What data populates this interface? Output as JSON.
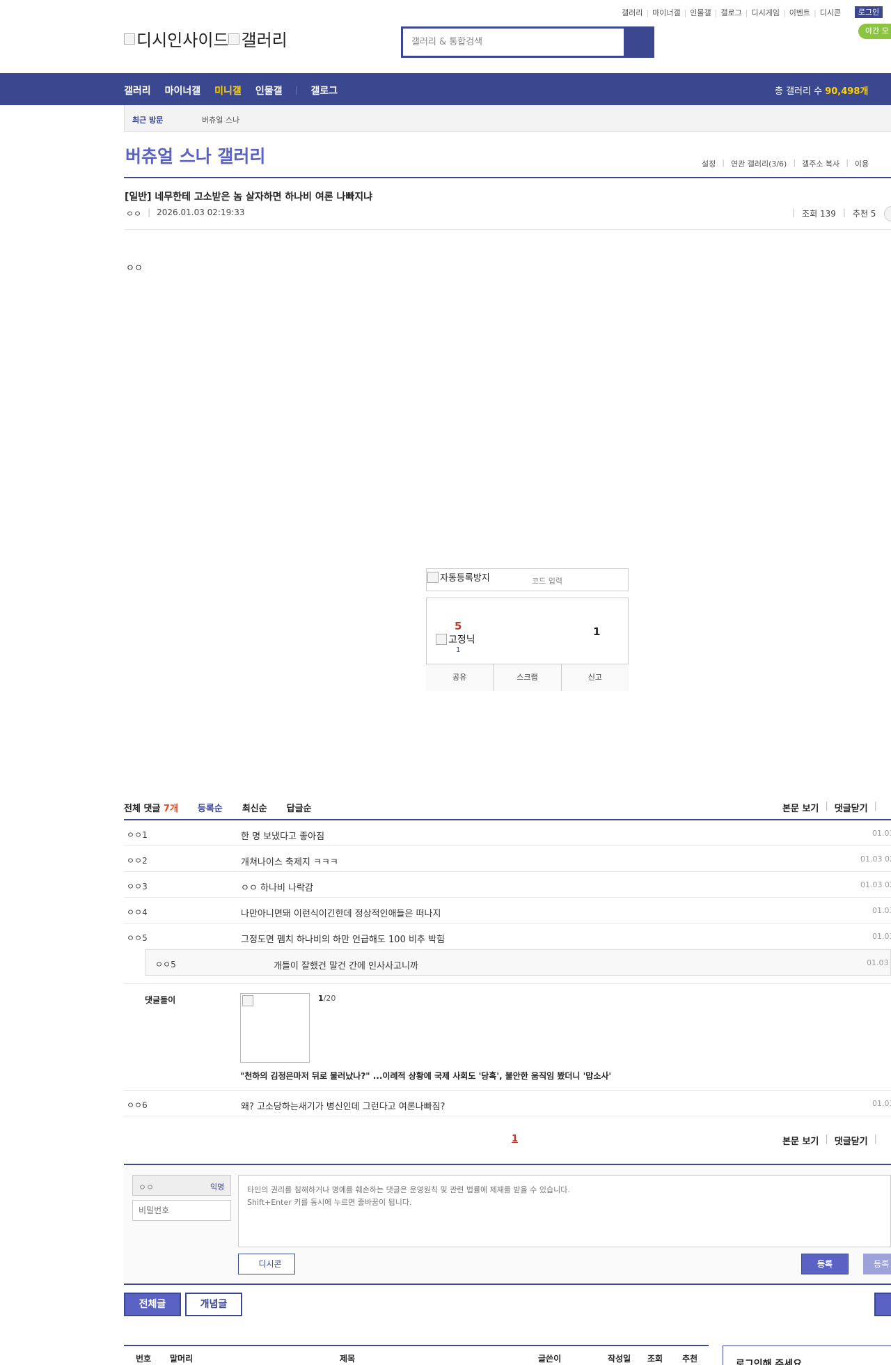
{
  "top_links": [
    "갤러리",
    "마이너갤",
    "인물갤",
    "갤로그",
    "디시게임",
    "이벤트",
    "디시콘"
  ],
  "login_label": "로그인",
  "night_mode_label": "야간 모",
  "logo_alt_left": "디시인사이드",
  "logo_alt_right": "갤러리",
  "search": {
    "placeholder": "갤러리 & 통합검색"
  },
  "nav": {
    "items": [
      "갤러리",
      "마이너갤",
      "미니갤",
      "인물갤",
      "갤로그"
    ],
    "active": "미니갤",
    "total_label": "총 갤러리 수",
    "total_value": "90,498개"
  },
  "recent": {
    "label": "최근 방문",
    "item": "버츄얼 스나"
  },
  "gallery": {
    "title": "버츄얼 스나 갤러리",
    "menu": [
      "설정",
      "연관 갤러리(3/6)",
      "갤주소 복사",
      "이용"
    ]
  },
  "post": {
    "title": "[일반] 네무한테 고소받은 놈 살자하면 하나비 여론 나빠지냐",
    "author": "ㅇㅇ",
    "datetime": "2026.01.03 02:19:33",
    "views_label": "조회 139",
    "recommend_label": "추천 5",
    "body": "ㅇㅇ"
  },
  "captcha": {
    "img_alt": "자동등록방지",
    "placeholder": "코드 입력"
  },
  "recommend": {
    "up_count": "5",
    "fixed_alt": "고정닉",
    "fixed_count": "1",
    "down_count": "1",
    "buttons": [
      "공유",
      "스크랩",
      "신고"
    ]
  },
  "comments": {
    "total_label": "전체 댓글",
    "total_count": "7개",
    "sorts": [
      "등록순",
      "최신순",
      "답글순"
    ],
    "view_body": "본문 보기",
    "close_comments": "댓글닫기",
    "rows": [
      {
        "nick": "ㅇㅇ1",
        "text": "한 명 보냈다고 좋아짐",
        "date": "01.03"
      },
      {
        "nick": "ㅇㅇ2",
        "text": "개쳐나이스 축제지 ㅋㅋㅋ",
        "date": "01.03 02"
      },
      {
        "nick": "ㅇㅇ3",
        "text": "ㅇㅇ 하나비 나락감",
        "date": "01.03 02"
      },
      {
        "nick": "ㅇㅇ4",
        "text": "나만아니면돼 이런식이긴한데 정상적인애들은 떠나지",
        "date": "01.03"
      },
      {
        "nick": "ㅇㅇ5",
        "text": "그정도면 펨치 하나비의 하만 언급해도 100 비추 박힘",
        "date": "01.03"
      }
    ],
    "reply": {
      "nick": "ㅇㅇ5",
      "text": "개들이 잘했건 말건 간에 인사사고니까",
      "date": "01.03 0"
    },
    "dolly": {
      "label": "댓글돌이",
      "page_current": "1",
      "page_total": "/20",
      "headline": "\"천하의 김정은마저 뒤로 물러났나?\" ...이례적 상황에 국제 사회도 '당혹', 불안한 움직임 봤더니 '맙소사'"
    },
    "last_row": {
      "nick": "ㅇㅇ6",
      "text": "왜? 고소당하는새기가 병신인데 그런다고 여론나빠짐?",
      "date": "01.03"
    },
    "page": "1"
  },
  "write": {
    "nick_value": "ㅇㅇ",
    "anon_label": "익명",
    "password_placeholder": "비밀번호",
    "textarea_placeholder": "타인의 권리를 침해하거나 명예를 훼손하는 댓글은 운영원칙 및 관련 법률에 제재를 받을 수 있습니다.\nShift+Enter 키를 동시에 누르면 줄바꿈이 됩니다.",
    "dccon_label": "디시콘",
    "register_label": "등록",
    "register2_label": "등록"
  },
  "list_tabs": {
    "all": "전체글",
    "concept": "개념글"
  },
  "list_header": [
    "번호",
    "말머리",
    "제목",
    "글쓴이",
    "작성일",
    "조회",
    "추천"
  ],
  "login_prompt": "로그인해 주세요."
}
